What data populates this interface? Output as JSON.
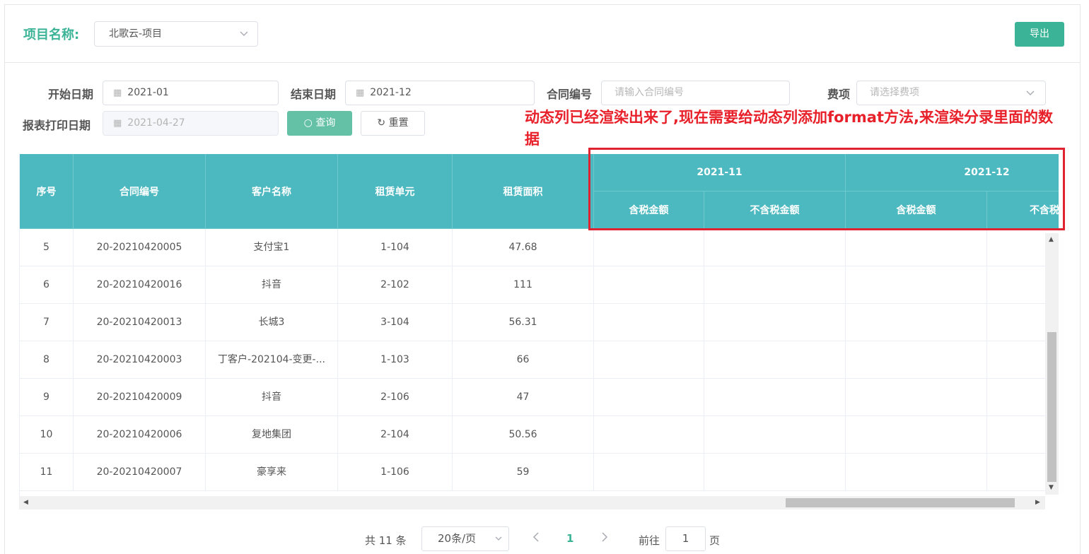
{
  "header": {
    "project_label": "项目名称:",
    "project_value": "北歌云-项目",
    "export_label": "导出"
  },
  "filters": {
    "start_label": "开始日期",
    "start_value": "2021-01",
    "end_label": "结束日期",
    "end_value": "2021-12",
    "contract_label": "合同编号",
    "contract_placeholder": "请输入合同编号",
    "fee_label": "费项",
    "fee_placeholder": "请选择费项",
    "print_label": "报表打印日期",
    "print_value": "2021-04-27",
    "query_label": "查询",
    "reset_label": "重置"
  },
  "annotation": "动态列已经渲染出来了,现在需要给动态列添加format方法,来渲染分录里面的数据",
  "table": {
    "columns": [
      "序号",
      "合同编号",
      "客户名称",
      "租赁单元",
      "租赁面积"
    ],
    "groups": [
      "2021-11",
      "2021-12"
    ],
    "subcolumns": [
      "含税金额",
      "不含税金额",
      "含税金额",
      "不含税"
    ],
    "rows": [
      [
        "5",
        "20-20210420005",
        "支付宝1",
        "1-104",
        "47.68"
      ],
      [
        "6",
        "20-20210420016",
        "抖音",
        "2-102",
        "111"
      ],
      [
        "7",
        "20-20210420013",
        "长城3",
        "3-104",
        "56.31"
      ],
      [
        "8",
        "20-20210420003",
        "丁客户-202104-变更-...",
        "1-103",
        "66"
      ],
      [
        "9",
        "20-20210420009",
        "抖音",
        "2-106",
        "47"
      ],
      [
        "10",
        "20-20210420006",
        "复地集团",
        "2-104",
        "50.56"
      ],
      [
        "11",
        "20-20210420007",
        "豪享来",
        "1-106",
        "59"
      ]
    ]
  },
  "pagination": {
    "total": "共 11 条",
    "page_size": "20条/页",
    "current_page": "1",
    "goto_label": "前往",
    "goto_value": "1",
    "page_suffix": "页"
  },
  "colors": {
    "accent": "#3bb396",
    "header_bg": "#4cb8bf",
    "annotation": "#e8202a"
  }
}
